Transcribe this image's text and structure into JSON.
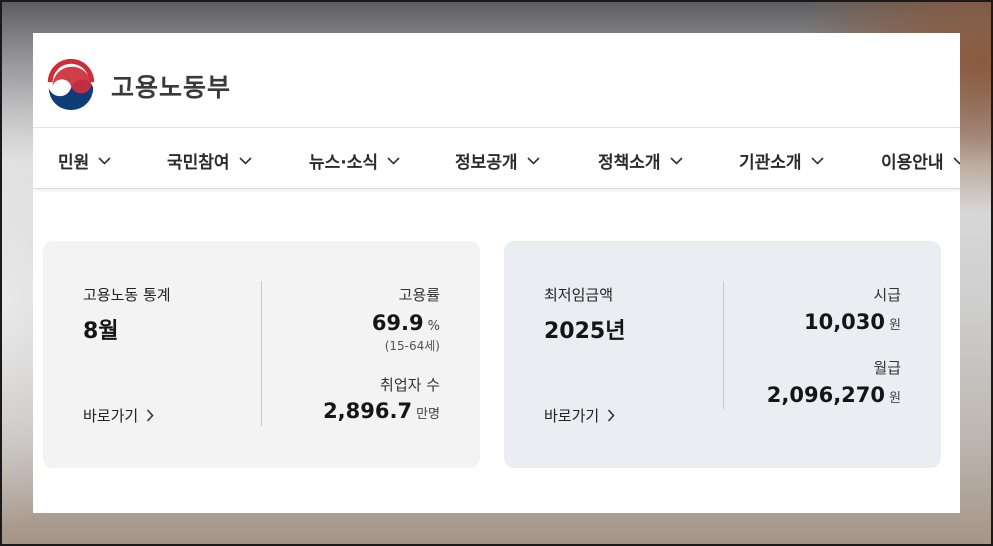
{
  "site": {
    "brand": "고용노동부"
  },
  "nav": [
    {
      "label": "민원"
    },
    {
      "label": "국민참여"
    },
    {
      "label": "뉴스·소식"
    },
    {
      "label": "정보공개"
    },
    {
      "label": "정책소개"
    },
    {
      "label": "기관소개"
    },
    {
      "label": "이용안내"
    }
  ],
  "labor_stats": {
    "title": "고용노동 통계",
    "period": "8월",
    "link_label": "바로가기",
    "employment_rate_label": "고용률",
    "employment_rate_value": "69.9",
    "employment_rate_unit": "%",
    "employment_rate_note": "(15-64세)",
    "employed_label": "취업자 수",
    "employed_value": "2,896.7",
    "employed_unit": "만명"
  },
  "min_wage": {
    "title": "최저임금액",
    "year": "2025년",
    "link_label": "바로가기",
    "hourly_label": "시급",
    "hourly_value": "10,030",
    "hourly_unit": "원",
    "monthly_label": "월급",
    "monthly_value": "2,096,270",
    "monthly_unit": "원"
  },
  "colors": {
    "logo_red": "#cd2e3a",
    "logo_blue": "#0f3d7a",
    "left_panel_bg": "#f3f3f4",
    "right_panel_bg": "#ecedf3"
  },
  "icons": {
    "logo": "taegeuk-emblem-icon",
    "nav_arrow": "chevron-down-icon",
    "link_arrow": "chevron-right-icon"
  }
}
